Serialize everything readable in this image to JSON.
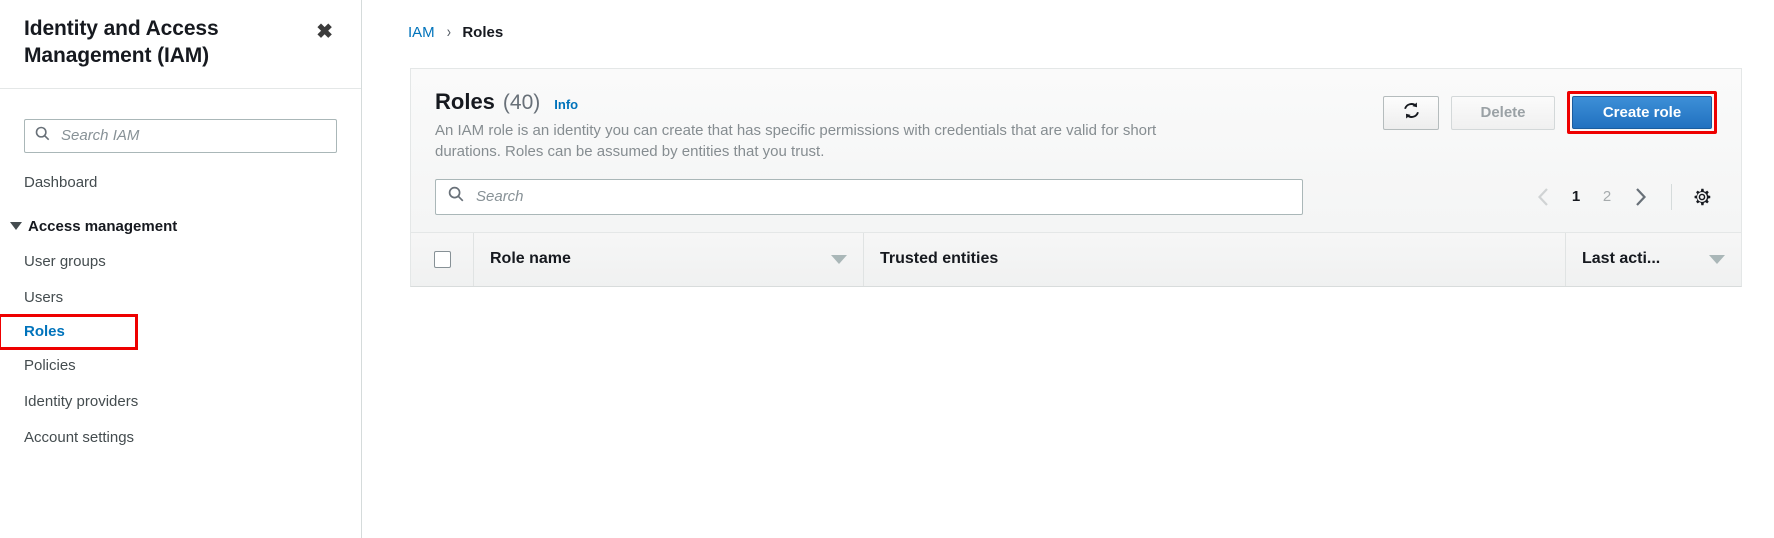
{
  "sidebar": {
    "title": "Identity and Access Management (IAM)",
    "close_label": "✖",
    "search_placeholder": "Search IAM",
    "items": [
      {
        "label": "Dashboard",
        "type": "item",
        "highlighted": false
      },
      {
        "label": "Access management",
        "type": "section",
        "highlighted": false
      },
      {
        "label": "User groups",
        "type": "item",
        "highlighted": false
      },
      {
        "label": "Users",
        "type": "item",
        "highlighted": false
      },
      {
        "label": "Roles",
        "type": "item",
        "highlighted": true
      },
      {
        "label": "Policies",
        "type": "item",
        "highlighted": false
      },
      {
        "label": "Identity providers",
        "type": "item",
        "highlighted": false
      },
      {
        "label": "Account settings",
        "type": "item",
        "highlighted": false
      }
    ]
  },
  "breadcrumb": {
    "root": "IAM",
    "separator": "›",
    "current": "Roles"
  },
  "panel": {
    "title": "Roles",
    "count": "(40)",
    "info_label": "Info",
    "description": "An IAM role is an identity you can create that has specific permissions with credentials that are valid for short durations. Roles can be assumed by entities that you trust.",
    "refresh_icon": "refresh-icon",
    "delete_label": "Delete",
    "create_label": "Create role"
  },
  "filter": {
    "search_placeholder": "Search",
    "prev_label": "‹",
    "next_label": "›",
    "pages": [
      "1",
      "2"
    ],
    "active_page": "1",
    "settings_icon": "gear-icon"
  },
  "table": {
    "columns": [
      {
        "label": "Role name",
        "sortable": true
      },
      {
        "label": "Trusted entities",
        "sortable": false
      },
      {
        "label": "Last acti...",
        "sortable": true
      }
    ],
    "rows": []
  },
  "colors": {
    "accent_blue": "#0073bb",
    "primary_button": "#2171c0",
    "highlight_red": "#ee0000",
    "text_dark": "#16191f",
    "text_muted": "#868d91"
  }
}
